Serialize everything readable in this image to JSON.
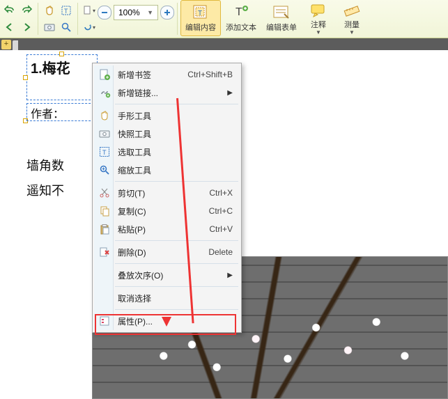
{
  "ribbon": {
    "zoom_value": "100%",
    "buttons": {
      "edit_content": "编辑内容",
      "add_text": "添加文本",
      "edit_form": "编辑表单",
      "annotate": "注释",
      "measure": "测量"
    }
  },
  "document": {
    "title": "1.梅花",
    "author_label": "作者：",
    "line1": "墙角数",
    "line2": "遥知不"
  },
  "context_menu": {
    "items": [
      {
        "label": "新增书签",
        "shortcut": "Ctrl+Shift+B",
        "icon": "bookmark-add-icon"
      },
      {
        "label": "新增链接...",
        "submenu": true,
        "icon": "link-add-icon"
      }
    ],
    "tools": [
      {
        "label": "手形工具",
        "icon": "hand-icon"
      },
      {
        "label": "快照工具",
        "icon": "camera-icon"
      },
      {
        "label": "选取工具",
        "icon": "select-text-icon"
      },
      {
        "label": "缩放工具",
        "icon": "zoom-icon"
      }
    ],
    "edit": [
      {
        "label": "剪切(T)",
        "shortcut": "Ctrl+X",
        "icon": "cut-icon"
      },
      {
        "label": "复制(C)",
        "shortcut": "Ctrl+C",
        "icon": "copy-icon"
      },
      {
        "label": "粘贴(P)",
        "shortcut": "Ctrl+V",
        "icon": "paste-icon"
      }
    ],
    "delete": {
      "label": "删除(D)",
      "shortcut": "Delete",
      "icon": "delete-icon"
    },
    "order": {
      "label": "叠放次序(O)",
      "submenu": true
    },
    "deselect": {
      "label": "取消选择"
    },
    "props": {
      "label": "属性(P)...",
      "icon": "properties-icon"
    }
  }
}
